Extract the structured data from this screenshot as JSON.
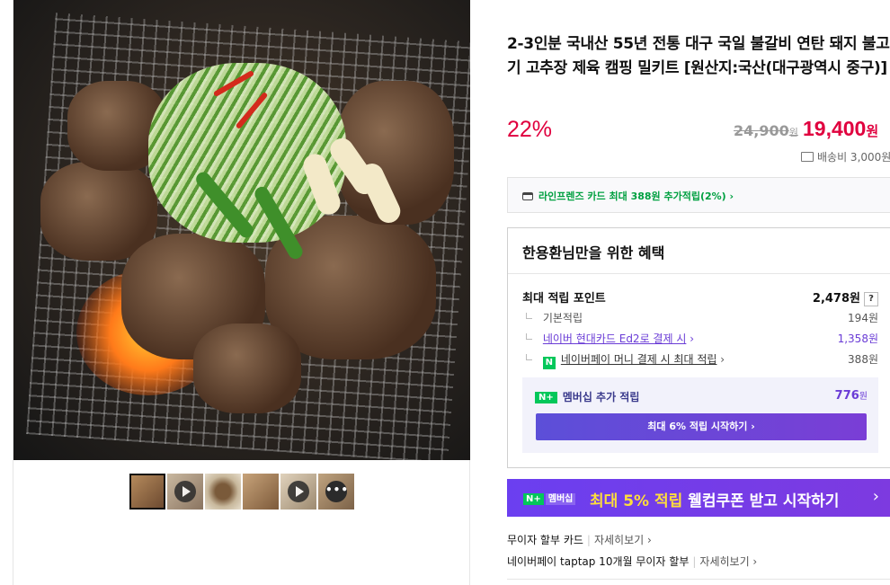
{
  "gallery": {
    "main_image_alt": "Grilled pork bulgogi with scallions and peppers on charcoal grill",
    "thumbnails": [
      {
        "name": "thumb-photo-1",
        "kind": "photo",
        "selected": true
      },
      {
        "name": "thumb-video-1",
        "kind": "video",
        "selected": false
      },
      {
        "name": "thumb-photo-2",
        "kind": "photo",
        "selected": false
      },
      {
        "name": "thumb-photo-3",
        "kind": "photo",
        "selected": false
      },
      {
        "name": "thumb-video-2",
        "kind": "video",
        "selected": false
      },
      {
        "name": "thumb-more",
        "kind": "more",
        "selected": false
      }
    ],
    "more_label": "•••"
  },
  "product": {
    "title": "2-3인분 국내산 55년 전통 대구 국일 불갈비 연탄 돼지 불고기 고추장 제육 캠핑 밀키트 [원산지:국산(대구광역시 중구)]",
    "discount": "22%",
    "original_price": "24,900",
    "original_price_unit": "원",
    "final_price": "19,400",
    "final_price_unit": "원",
    "shipping": "배송비 3,000원"
  },
  "card_offer": {
    "text": "라인프렌즈 카드 최대 388원 추가적립(2%)",
    "chevron": "›"
  },
  "benefits": {
    "title": "한용환님만을 위한 혜택",
    "max_points_label": "최대 적립 포인트",
    "max_points_value": "2,478원",
    "help": "?",
    "basic_label": "기본적립",
    "basic_value": "194원",
    "card_label": "네이버 현대카드 Ed2로 결제 시",
    "card_value": "1,358원",
    "npay_badge": "N",
    "npay_label": "네이버페이 머니 결제 시 최대 적립",
    "npay_value": "388원",
    "chevron": "›",
    "membership": {
      "logo": "N+",
      "label": "멤버십 추가 적립",
      "value": "776",
      "unit": "원",
      "button": "최대 6% 적립 시작하기 ›"
    }
  },
  "promo": {
    "logo_n": "N+",
    "logo_m": "멤버십",
    "highlight": "최대 5% 적립",
    "text": " 웰컴쿠폰 받고 시작하기",
    "arrow": "›"
  },
  "payment": {
    "row1_label": "무이자 할부 카드",
    "row1_more": "자세히보기 ›",
    "row2_label": "네이버페이 taptap 10개월 무이자 할부",
    "row2_more": "자세히보기 ›",
    "sep": "|"
  },
  "colors": {
    "sale_red": "#e0003e",
    "naver_green": "#03c75a",
    "membership_purple": "#6a3cd6"
  }
}
